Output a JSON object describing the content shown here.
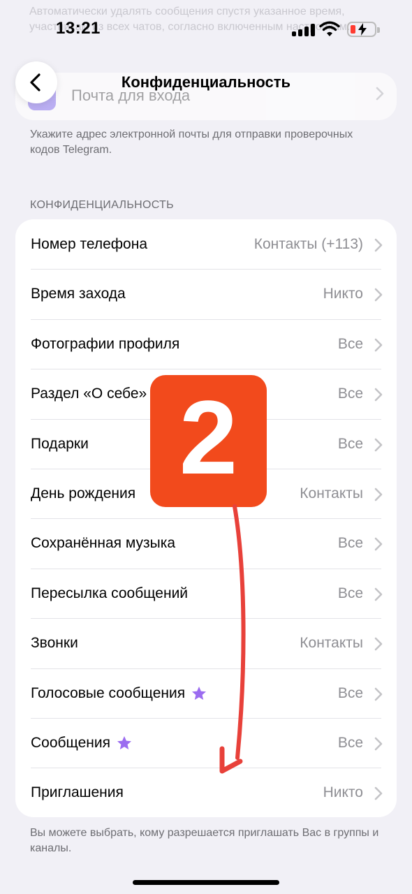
{
  "status_bar": {
    "time": "13:21"
  },
  "background_text": "Автоматически удалять сообщения спустя указанное время, участникам из всех чатов, согласно включенным настройкам.",
  "nav": {
    "title": "Конфиденциальность"
  },
  "email": {
    "label": "Почта для входа",
    "footer": "Укажите адрес электронной почты для отправки проверочных кодов Telegram."
  },
  "privacy": {
    "header": "КОНФИДЕНЦИАЛЬНОСТЬ",
    "rows": [
      {
        "label": "Номер телефона",
        "value": "Контакты (+113)"
      },
      {
        "label": "Время захода",
        "value": "Никто"
      },
      {
        "label": "Фотографии профиля",
        "value": "Все"
      },
      {
        "label": "Раздел «О себе»",
        "value": "Все"
      },
      {
        "label": "Подарки",
        "value": "Все"
      },
      {
        "label": "День рождения",
        "value": "Контакты"
      },
      {
        "label": "Сохранённая музыка",
        "value": "Все"
      },
      {
        "label": "Пересылка сообщений",
        "value": "Все"
      },
      {
        "label": "Звонки",
        "value": "Контакты"
      },
      {
        "label": "Голосовые сообщения",
        "value": "Все",
        "premium": true
      },
      {
        "label": "Сообщения",
        "value": "Все",
        "premium": true
      },
      {
        "label": "Приглашения",
        "value": "Никто"
      }
    ],
    "footer": "Вы можете выбрать, кому разрешается приглашать Вас в группы и каналы."
  },
  "annotation": {
    "step_number": "2",
    "badge_color": "#f24a1c",
    "arrow_color": "#e8413a"
  },
  "colors": {
    "premium_star": "#9b6cf0",
    "background": "#f1f0f6"
  }
}
